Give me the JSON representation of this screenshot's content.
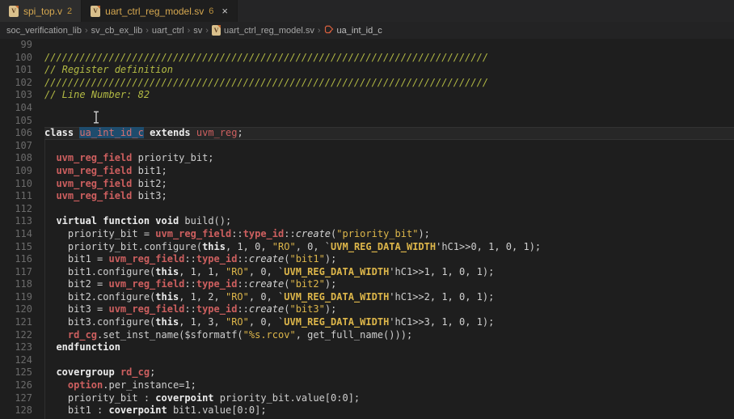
{
  "tabs": [
    {
      "label": "spi_top.v",
      "badge": "2",
      "active": false
    },
    {
      "label": "uart_ctrl_reg_model.sv",
      "badge": "6",
      "active": true
    }
  ],
  "icons": {
    "file_icon": "verilog-file-icon",
    "file_icon_letter": "V",
    "class_symbol_icon": "symbol-class",
    "close_glyph": "×",
    "breadcrumb_separator": "›"
  },
  "breadcrumb": {
    "items": [
      {
        "label": "soc_verification_lib"
      },
      {
        "label": "sv_cb_ex_lib"
      },
      {
        "label": "uart_ctrl"
      },
      {
        "label": "sv"
      },
      {
        "label": "uart_ctrl_reg_model.sv",
        "icon": "file"
      },
      {
        "label": "ua_int_id_c",
        "icon": "class"
      }
    ]
  },
  "colors": {
    "editor_bg": "#1e1e1e",
    "tabbar_bg": "#252526",
    "inactive_tab_bg": "#2d2d2d",
    "tab_text": "#d6a850",
    "keyword": "#ececec",
    "type_red": "#cd5f5f",
    "string_yellow": "#ddb64a",
    "comment_olive": "#b3ba44",
    "occurrence_highlight_bg": "#1e4c6d",
    "line_number": "#6b6b6b"
  },
  "editor": {
    "first_line_number": 99,
    "lines": [
      {
        "n": "99",
        "tk": []
      },
      {
        "n": "100",
        "tk": [
          [
            "com",
            "////////////////////////////////////////////////////////////////////////////"
          ]
        ]
      },
      {
        "n": "101",
        "tk": [
          [
            "com",
            "// Register definition"
          ]
        ]
      },
      {
        "n": "102",
        "tk": [
          [
            "com",
            "////////////////////////////////////////////////////////////////////////////"
          ]
        ]
      },
      {
        "n": "103",
        "tk": [
          [
            "com",
            "// Line Number: 82"
          ]
        ]
      },
      {
        "n": "104",
        "tk": []
      },
      {
        "n": "105",
        "tk": []
      },
      {
        "n": "106",
        "cur": true,
        "tk": [
          [
            "kw",
            "class"
          ],
          [
            "p",
            " "
          ],
          [
            "hl",
            "ua_int_id_c"
          ],
          [
            "p",
            " "
          ],
          [
            "kw",
            "extends"
          ],
          [
            "p",
            " "
          ],
          [
            "red",
            "uvm_reg"
          ],
          [
            "p",
            ";"
          ]
        ]
      },
      {
        "n": "107",
        "tk": []
      },
      {
        "n": "108",
        "tk": [
          [
            "p",
            "  "
          ],
          [
            "type",
            "uvm_reg_field"
          ],
          [
            "p",
            " priority_bit;"
          ]
        ]
      },
      {
        "n": "109",
        "tk": [
          [
            "p",
            "  "
          ],
          [
            "type",
            "uvm_reg_field"
          ],
          [
            "p",
            " bit1;"
          ]
        ]
      },
      {
        "n": "110",
        "tk": [
          [
            "p",
            "  "
          ],
          [
            "type",
            "uvm_reg_field"
          ],
          [
            "p",
            " bit2;"
          ]
        ]
      },
      {
        "n": "111",
        "tk": [
          [
            "p",
            "  "
          ],
          [
            "type",
            "uvm_reg_field"
          ],
          [
            "p",
            " bit3;"
          ]
        ]
      },
      {
        "n": "112",
        "tk": []
      },
      {
        "n": "113",
        "tk": [
          [
            "p",
            "  "
          ],
          [
            "kw",
            "virtual"
          ],
          [
            "p",
            " "
          ],
          [
            "kw",
            "function"
          ],
          [
            "p",
            " "
          ],
          [
            "kw",
            "void"
          ],
          [
            "p",
            " build();"
          ]
        ]
      },
      {
        "n": "114",
        "tk": [
          [
            "p",
            "    priority_bit = "
          ],
          [
            "type",
            "uvm_reg_field"
          ],
          [
            "p",
            "::"
          ],
          [
            "type",
            "type_id"
          ],
          [
            "p",
            "::"
          ],
          [
            "it",
            "create"
          ],
          [
            "p",
            "("
          ],
          [
            "str",
            "\"priority_bit\""
          ],
          [
            "p",
            ");"
          ]
        ]
      },
      {
        "n": "115",
        "tk": [
          [
            "p",
            "    priority_bit.configure("
          ],
          [
            "kw",
            "this"
          ],
          [
            "p",
            ", 1, 0, "
          ],
          [
            "str",
            "\"RO\""
          ],
          [
            "p",
            ", 0, `"
          ],
          [
            "mac",
            "UVM_REG_DATA_WIDTH"
          ],
          [
            "p",
            "'hC1>>0, 1, 0, 1);"
          ]
        ]
      },
      {
        "n": "116",
        "tk": [
          [
            "p",
            "    bit1 = "
          ],
          [
            "type",
            "uvm_reg_field"
          ],
          [
            "p",
            "::"
          ],
          [
            "type",
            "type_id"
          ],
          [
            "p",
            "::"
          ],
          [
            "it",
            "create"
          ],
          [
            "p",
            "("
          ],
          [
            "str",
            "\"bit1\""
          ],
          [
            "p",
            ");"
          ]
        ]
      },
      {
        "n": "117",
        "tk": [
          [
            "p",
            "    bit1.configure("
          ],
          [
            "kw",
            "this"
          ],
          [
            "p",
            ", 1, 1, "
          ],
          [
            "str",
            "\"RO\""
          ],
          [
            "p",
            ", 0, `"
          ],
          [
            "mac",
            "UVM_REG_DATA_WIDTH"
          ],
          [
            "p",
            "'hC1>>1, 1, 0, 1);"
          ]
        ]
      },
      {
        "n": "118",
        "tk": [
          [
            "p",
            "    bit2 = "
          ],
          [
            "type",
            "uvm_reg_field"
          ],
          [
            "p",
            "::"
          ],
          [
            "type",
            "type_id"
          ],
          [
            "p",
            "::"
          ],
          [
            "it",
            "create"
          ],
          [
            "p",
            "("
          ],
          [
            "str",
            "\"bit2\""
          ],
          [
            "p",
            ");"
          ]
        ]
      },
      {
        "n": "119",
        "tk": [
          [
            "p",
            "    bit2.configure("
          ],
          [
            "kw",
            "this"
          ],
          [
            "p",
            ", 1, 2, "
          ],
          [
            "str",
            "\"RO\""
          ],
          [
            "p",
            ", 0, `"
          ],
          [
            "mac",
            "UVM_REG_DATA_WIDTH"
          ],
          [
            "p",
            "'hC1>>2, 1, 0, 1);"
          ]
        ]
      },
      {
        "n": "120",
        "tk": [
          [
            "p",
            "    bit3 = "
          ],
          [
            "type",
            "uvm_reg_field"
          ],
          [
            "p",
            "::"
          ],
          [
            "type",
            "type_id"
          ],
          [
            "p",
            "::"
          ],
          [
            "it",
            "create"
          ],
          [
            "p",
            "("
          ],
          [
            "str",
            "\"bit3\""
          ],
          [
            "p",
            ");"
          ]
        ]
      },
      {
        "n": "121",
        "tk": [
          [
            "p",
            "    bit3.configure("
          ],
          [
            "kw",
            "this"
          ],
          [
            "p",
            ", 1, 3, "
          ],
          [
            "str",
            "\"RO\""
          ],
          [
            "p",
            ", 0, `"
          ],
          [
            "mac",
            "UVM_REG_DATA_WIDTH"
          ],
          [
            "p",
            "'hC1>>3, 1, 0, 1);"
          ]
        ]
      },
      {
        "n": "122",
        "tk": [
          [
            "p",
            "    "
          ],
          [
            "type",
            "rd_cg"
          ],
          [
            "p",
            ".set_inst_name($sformatf("
          ],
          [
            "str",
            "\"%s.rcov\""
          ],
          [
            "p",
            ", get_full_name()));"
          ]
        ]
      },
      {
        "n": "123",
        "tk": [
          [
            "p",
            "  "
          ],
          [
            "kw",
            "endfunction"
          ]
        ]
      },
      {
        "n": "124",
        "tk": []
      },
      {
        "n": "125",
        "tk": [
          [
            "p",
            "  "
          ],
          [
            "kw",
            "covergroup"
          ],
          [
            "p",
            " "
          ],
          [
            "type",
            "rd_cg"
          ],
          [
            "p",
            ";"
          ]
        ]
      },
      {
        "n": "126",
        "tk": [
          [
            "p",
            "    "
          ],
          [
            "type",
            "option"
          ],
          [
            "p",
            ".per_instance=1;"
          ]
        ]
      },
      {
        "n": "127",
        "tk": [
          [
            "p",
            "    priority_bit : "
          ],
          [
            "kw",
            "coverpoint"
          ],
          [
            "p",
            " priority_bit.value[0:0];"
          ]
        ]
      },
      {
        "n": "128",
        "tk": [
          [
            "p",
            "    bit1 : "
          ],
          [
            "kw",
            "coverpoint"
          ],
          [
            "p",
            " bit1.value[0:0];"
          ]
        ]
      }
    ]
  }
}
